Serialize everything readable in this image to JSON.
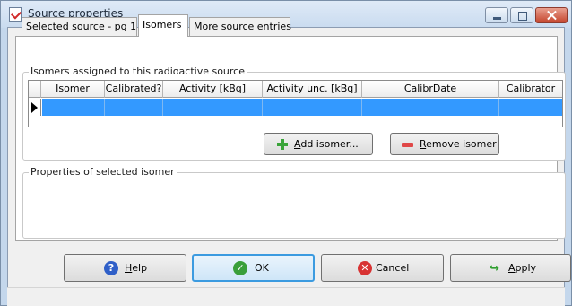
{
  "window": {
    "title": "Source properties"
  },
  "tabs": [
    {
      "label": "Selected source - pg 1",
      "active": false
    },
    {
      "label": "Isomers",
      "active": true
    },
    {
      "label": "More source entries",
      "active": false
    }
  ],
  "isomers_group": {
    "label": "Isomers assigned to this radioactive source",
    "columns": [
      "Isomer",
      "Calibrated?",
      "Activity [kBq]",
      "Activity unc. [kBq]",
      "CalibrDate",
      "Calibrator"
    ],
    "rows": [
      [
        "",
        "",
        "",
        "",
        "",
        ""
      ]
    ],
    "add_button": {
      "access_key": "A",
      "rest": "dd isomer...",
      "icon": "plus-icon"
    },
    "remove_button": {
      "access_key": "R",
      "rest": "emove isomer",
      "icon": "minus-icon"
    }
  },
  "properties_group": {
    "label": "Properties of selected isomer"
  },
  "footer": {
    "help": {
      "access_key": "H",
      "rest": "elp",
      "icon": "help-icon"
    },
    "ok": {
      "label": "OK",
      "icon": "checkmark-icon"
    },
    "cancel": {
      "label": "Cancel",
      "icon": "cancel-icon"
    },
    "apply": {
      "access_key": "A",
      "rest": "pply",
      "icon": "apply-arrow-icon"
    }
  },
  "colors": {
    "selection": "#3399ff",
    "title_bar": "#c9dbef",
    "close_button": "#c5462e"
  }
}
